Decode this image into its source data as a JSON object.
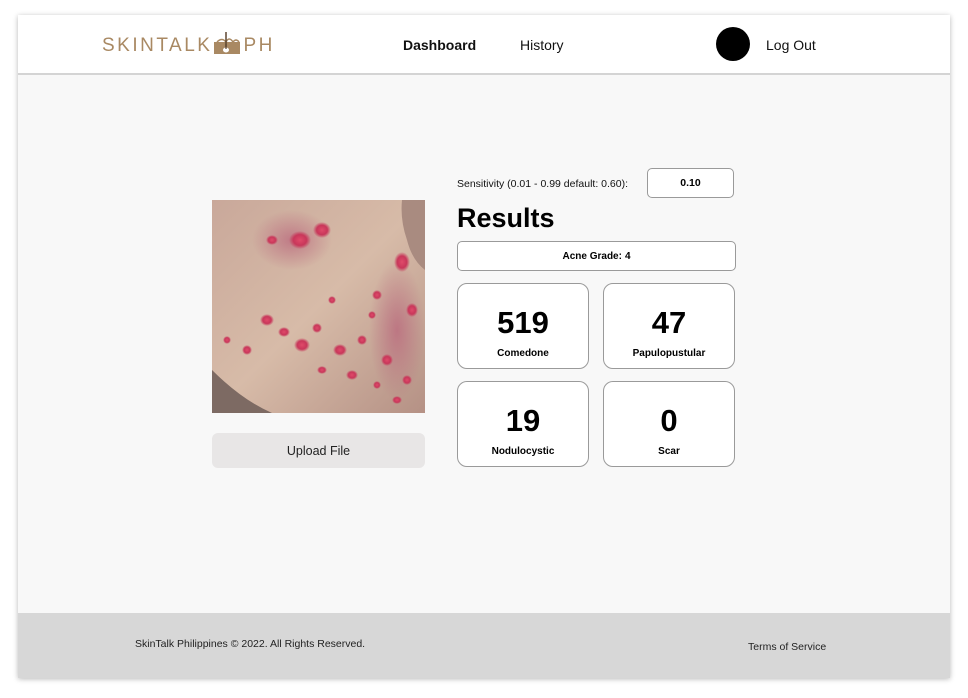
{
  "header": {
    "logo": {
      "left": "SKINTALK",
      "right": "PH",
      "color": "#a98963",
      "icon": "hair-follicle-icon"
    },
    "nav": {
      "dashboard": "Dashboard",
      "history": "History"
    },
    "logout": "Log Out"
  },
  "main": {
    "photo_description": "close-up photo of skin with acne lesions",
    "upload_label": "Upload File",
    "sensitivity": {
      "label": "Sensitivity (0.01 - 0.99 default: 0.60):",
      "value": "0.10"
    },
    "results_title": "Results",
    "acne_grade": {
      "label": "Acne Grade:",
      "value": "4"
    },
    "counts": [
      {
        "value": "519",
        "label": "Comedone"
      },
      {
        "value": "47",
        "label": "Papulopustular"
      },
      {
        "value": "19",
        "label": "Nodulocystic"
      },
      {
        "value": "0",
        "label": "Scar"
      }
    ]
  },
  "footer": {
    "copyright": "SkinTalk Philippines © 2022. All Rights Reserved.",
    "terms": "Terms of Service"
  }
}
